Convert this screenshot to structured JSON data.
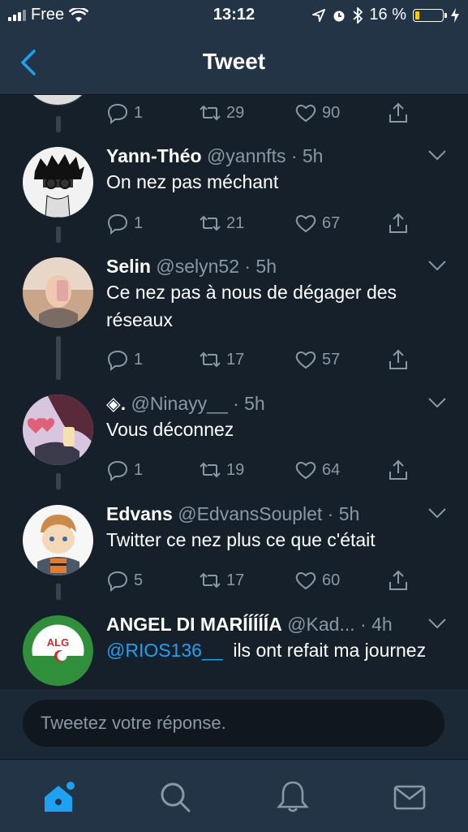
{
  "status": {
    "carrier": "Free",
    "time": "13:12",
    "battery": "16 %",
    "battery_level": 0.16
  },
  "nav": {
    "title": "Tweet"
  },
  "top_tweet": {
    "replies": "1",
    "retweets": "29",
    "likes": "90"
  },
  "tweets": [
    {
      "name": "Yann-Théo",
      "meta": "@yannfts · 5h",
      "text": "On nez pas méchant",
      "replies": "1",
      "retweets": "21",
      "likes": "67"
    },
    {
      "name": "Selin",
      "meta": "@selyn52 · 5h",
      "text": "Ce nez pas à nous de dégager des réseaux",
      "replies": "1",
      "retweets": "17",
      "likes": "57"
    },
    {
      "name": "◈.",
      "meta": "@Ninayy__ · 5h",
      "text": "Vous déconnez",
      "replies": "1",
      "retweets": "19",
      "likes": "64"
    },
    {
      "name": "Edvans",
      "meta": "@EdvansSouplet · 5h",
      "text": "Twitter ce nez plus ce que c'était",
      "replies": "5",
      "retweets": "17",
      "likes": "60"
    },
    {
      "name": "ANGEL DI MARÍÍÍÍÍA",
      "meta": "@Kad... · 4h",
      "mention": "@RIOS136__",
      "text": "ils ont refait ma journez",
      "avatar_text": "ALG"
    }
  ],
  "reply": {
    "placeholder": "Tweetez votre réponse."
  },
  "icons": {
    "accent": "#1da1f2",
    "tabs": [
      "home-icon",
      "search-icon",
      "notifications-icon",
      "messages-icon"
    ]
  }
}
